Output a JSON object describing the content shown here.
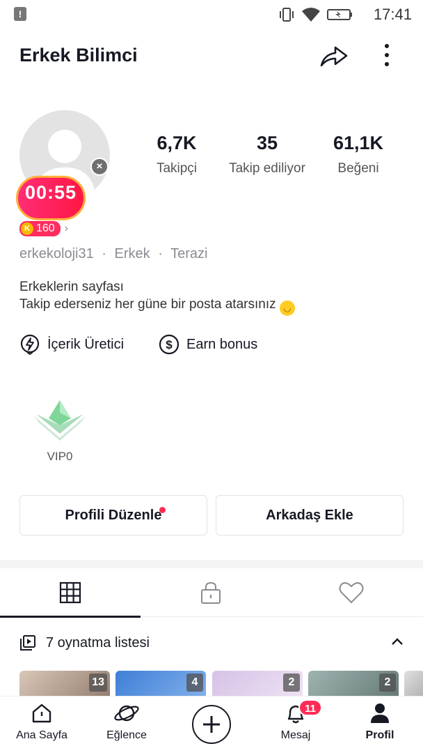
{
  "status_bar": {
    "time": "17:41",
    "alert": "!"
  },
  "header": {
    "title": "Erkek Bilimci"
  },
  "avatar": {
    "timer": "00:55",
    "coins": "160",
    "coin_symbol": "K"
  },
  "stats": [
    {
      "value": "6,7K",
      "label": "Takipçi"
    },
    {
      "value": "35",
      "label": "Takip ediliyor"
    },
    {
      "value": "61,1K",
      "label": "Beğeni"
    }
  ],
  "meta": {
    "username": "erkekoloji31",
    "gender": "Erkek",
    "sign": "Terazi",
    "separator": "·"
  },
  "bio": {
    "line1": "Erkeklerin sayfası",
    "line2": "Takip ederseniz her güne bir posta atarsınız"
  },
  "features": {
    "creator": "İçerik Üretici",
    "earn": "Earn bonus"
  },
  "vip": {
    "label": "VIP0"
  },
  "buttons": {
    "edit_profile": "Profili Düzenle",
    "add_friend": "Arkadaş Ekle"
  },
  "playlist": {
    "label": "7 oynatma listesi"
  },
  "thumbnails": [
    {
      "count": "13"
    },
    {
      "count": "4"
    },
    {
      "count": "2"
    },
    {
      "count": "2"
    }
  ],
  "nav": {
    "home": "Ana Sayfa",
    "fun": "Eğlence",
    "messages": "Mesaj",
    "messages_badge": "11",
    "profile": "Profil"
  },
  "colors": {
    "accent": "#fe2c55",
    "text": "#161823",
    "muted": "#8a8b91"
  }
}
